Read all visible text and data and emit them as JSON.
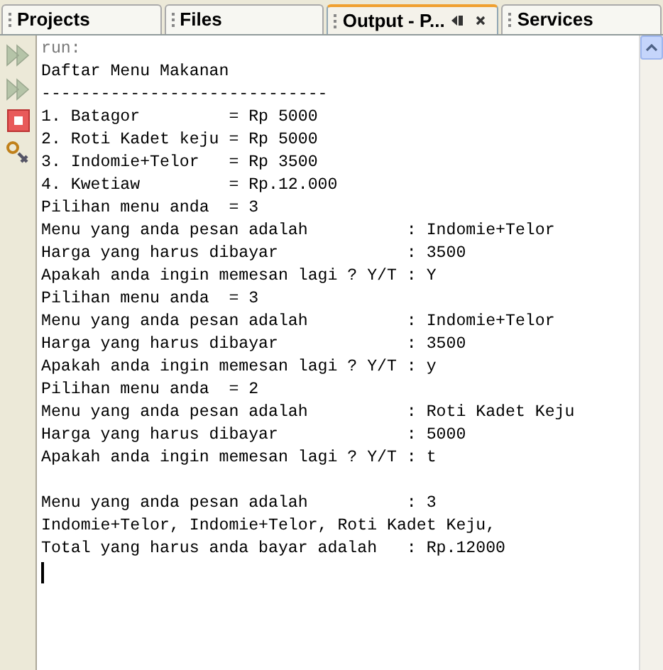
{
  "tabs": [
    {
      "label": "Projects",
      "selected": false
    },
    {
      "label": "Files",
      "selected": false
    },
    {
      "label": "Output - P...",
      "selected": true
    },
    {
      "label": "Services",
      "selected": false
    }
  ],
  "toolbar": [
    {
      "kind": "rerun",
      "disabled": true
    },
    {
      "kind": "rerun",
      "disabled": true
    },
    {
      "kind": "stop",
      "disabled": false
    },
    {
      "kind": "settings",
      "disabled": false
    }
  ],
  "output_lines": [
    {
      "kind": "system",
      "text": "run:"
    },
    {
      "kind": "text",
      "text": "Daftar Menu Makanan"
    },
    {
      "kind": "text",
      "text": "-----------------------------"
    },
    {
      "kind": "text",
      "text": "1. Batagor         = Rp 5000"
    },
    {
      "kind": "text",
      "text": "2. Roti Kadet keju = Rp 5000"
    },
    {
      "kind": "text",
      "text": "3. Indomie+Telor   = Rp 3500"
    },
    {
      "kind": "text",
      "text": "4. Kwetiaw         = Rp.12.000"
    },
    {
      "kind": "text",
      "text": "Pilihan menu anda  = 3"
    },
    {
      "kind": "text",
      "text": "Menu yang anda pesan adalah          : Indomie+Telor"
    },
    {
      "kind": "text",
      "text": "Harga yang harus dibayar             : 3500"
    },
    {
      "kind": "text",
      "text": "Apakah anda ingin memesan lagi ? Y/T : Y"
    },
    {
      "kind": "text",
      "text": "Pilihan menu anda  = 3"
    },
    {
      "kind": "text",
      "text": "Menu yang anda pesan adalah          : Indomie+Telor"
    },
    {
      "kind": "text",
      "text": "Harga yang harus dibayar             : 3500"
    },
    {
      "kind": "text",
      "text": "Apakah anda ingin memesan lagi ? Y/T : y"
    },
    {
      "kind": "text",
      "text": "Pilihan menu anda  = 2"
    },
    {
      "kind": "text",
      "text": "Menu yang anda pesan adalah          : Roti Kadet Keju"
    },
    {
      "kind": "text",
      "text": "Harga yang harus dibayar             : 5000"
    },
    {
      "kind": "text",
      "text": "Apakah anda ingin memesan lagi ? Y/T : t"
    },
    {
      "kind": "blank"
    },
    {
      "kind": "text",
      "text": "Menu yang anda pesan adalah          : 3"
    },
    {
      "kind": "text",
      "text": "Indomie+Telor, Indomie+Telor, Roti Kadet Keju,"
    },
    {
      "kind": "text",
      "text": "Total yang harus anda bayar adalah   : Rp.12000"
    },
    {
      "kind": "cursor"
    }
  ]
}
